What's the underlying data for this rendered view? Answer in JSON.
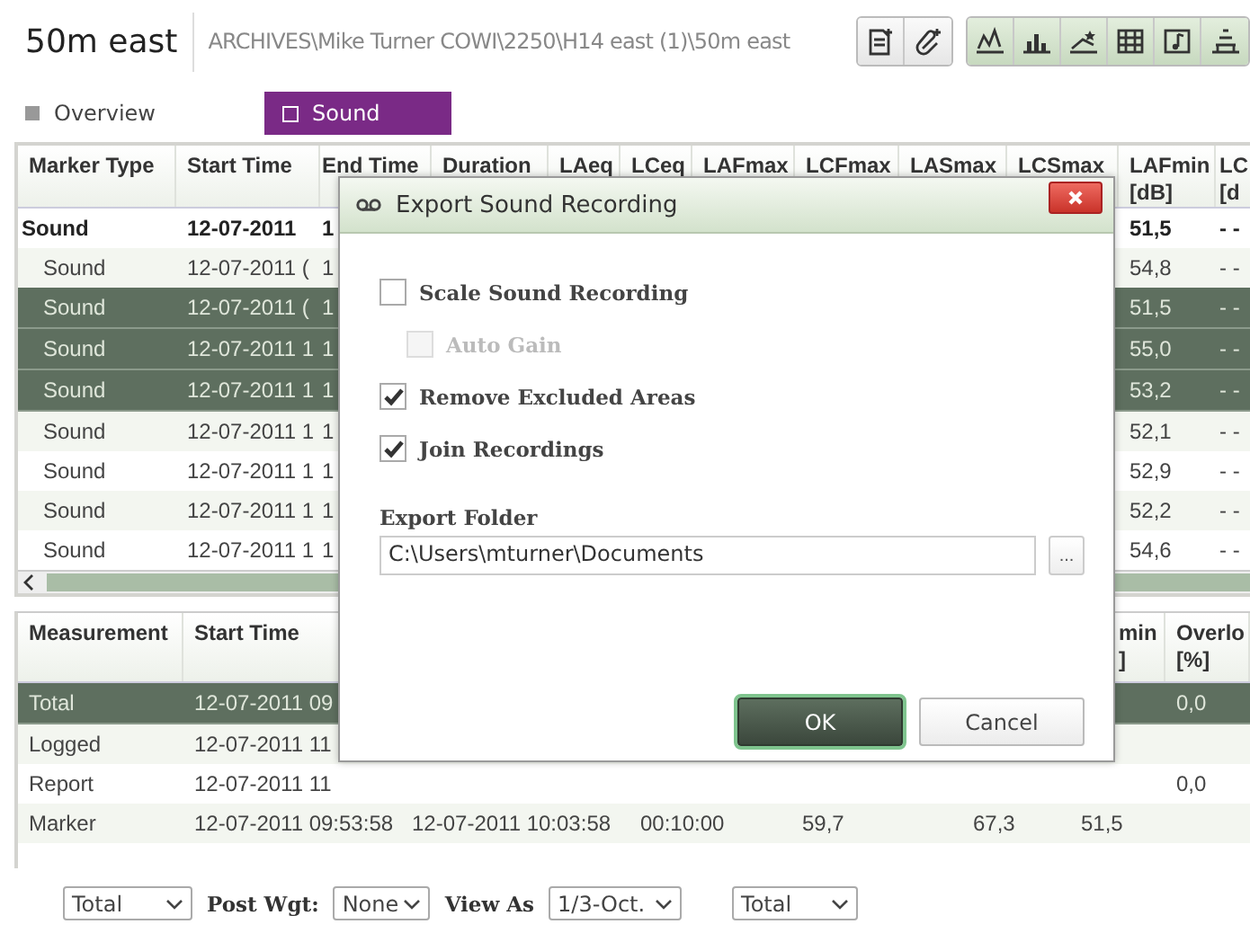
{
  "header": {
    "title": "50m east",
    "path": "ARCHIVES\\Mike Turner COWI\\2250\\H14 east (1)\\50m east"
  },
  "tabs": [
    {
      "label": "Overview",
      "selected": false
    },
    {
      "label": "Sound",
      "selected": true
    }
  ],
  "marker_table": {
    "columns": [
      "Marker Type",
      "Start Time",
      "End Time",
      "Duration",
      "LAeq",
      "LCeq",
      "LAFmax",
      "LCFmax",
      "LASmax",
      "LCSmax",
      "LAFmin\n[dB]",
      "LC\n[d"
    ],
    "rows": [
      {
        "kind": "summary",
        "selected": false,
        "cells": [
          "Sound",
          "12-07-2011",
          "1",
          null,
          null,
          null,
          null,
          null,
          null,
          null,
          "51,5",
          "- -"
        ]
      },
      {
        "kind": "item",
        "selected": false,
        "cells": [
          "Sound",
          "12-07-2011 (",
          "1",
          null,
          null,
          null,
          null,
          null,
          null,
          null,
          "54,8",
          "- -"
        ]
      },
      {
        "kind": "item",
        "selected": true,
        "cells": [
          "Sound",
          "12-07-2011 (",
          "1",
          null,
          null,
          null,
          null,
          null,
          null,
          null,
          "51,5",
          "- -"
        ]
      },
      {
        "kind": "item",
        "selected": true,
        "cells": [
          "Sound",
          "12-07-2011 1",
          "1",
          null,
          null,
          null,
          null,
          null,
          null,
          null,
          "55,0",
          "- -"
        ]
      },
      {
        "kind": "item",
        "selected": true,
        "cells": [
          "Sound",
          "12-07-2011 1",
          "1",
          null,
          null,
          null,
          null,
          null,
          null,
          null,
          "53,2",
          "- -"
        ]
      },
      {
        "kind": "item",
        "selected": false,
        "cells": [
          "Sound",
          "12-07-2011 1",
          "1",
          null,
          null,
          null,
          null,
          null,
          null,
          null,
          "52,1",
          "- -"
        ]
      },
      {
        "kind": "item",
        "selected": false,
        "cells": [
          "Sound",
          "12-07-2011 1",
          "1",
          null,
          null,
          null,
          null,
          null,
          null,
          null,
          "52,9",
          "- -"
        ]
      },
      {
        "kind": "item",
        "selected": false,
        "cells": [
          "Sound",
          "12-07-2011 1",
          "1",
          null,
          null,
          null,
          null,
          null,
          null,
          null,
          "52,2",
          "- -"
        ]
      },
      {
        "kind": "item",
        "selected": false,
        "cells": [
          "Sound",
          "12-07-2011 1",
          "1",
          null,
          null,
          null,
          null,
          null,
          null,
          null,
          "54,6",
          "- -"
        ]
      }
    ]
  },
  "measurement_table": {
    "columns": [
      "Measurement",
      "Start Time",
      null,
      null,
      null,
      null,
      null,
      "min\n]",
      "Overlo\n[%]"
    ],
    "rows": [
      {
        "selected": true,
        "cells": [
          "Total",
          "12-07-2011 09",
          null,
          null,
          null,
          null,
          null,
          null,
          "0,0"
        ]
      },
      {
        "selected": false,
        "cells": [
          "Logged",
          "12-07-2011 11",
          null,
          null,
          null,
          null,
          null,
          null,
          null
        ]
      },
      {
        "selected": false,
        "cells": [
          "Report",
          "12-07-2011 11",
          null,
          null,
          null,
          null,
          null,
          null,
          "0,0"
        ]
      },
      {
        "selected": false,
        "cells": [
          "Marker",
          "12-07-2011 09:53:58",
          "12-07-2011 10:03:58",
          "00:10:00",
          "59,7",
          null,
          "67,3",
          "51,5",
          null
        ]
      }
    ]
  },
  "dialog": {
    "title": "Export Sound Recording",
    "options": [
      {
        "label": "Scale Sound Recording",
        "checked": false,
        "disabled": false,
        "indented": false
      },
      {
        "label": "Auto Gain",
        "checked": false,
        "disabled": true,
        "indented": true
      },
      {
        "label": "Remove Excluded Areas",
        "checked": true,
        "disabled": false,
        "indented": false
      },
      {
        "label": "Join Recordings",
        "checked": true,
        "disabled": false,
        "indented": false
      }
    ],
    "folder_label": "Export Folder",
    "folder_value": "C:\\Users\\mturner\\Documents",
    "browse": "...",
    "buttons": [
      {
        "label": "OK",
        "kind": "primary"
      },
      {
        "label": "Cancel",
        "kind": "secondary"
      }
    ]
  },
  "bottom_bar": [
    {
      "kind": "select",
      "text": "Total"
    },
    {
      "kind": "label",
      "text": "Post Wgt:"
    },
    {
      "kind": "select",
      "text": "None"
    },
    {
      "kind": "label",
      "text": "View As"
    },
    {
      "kind": "select",
      "text": "1/3-Oct."
    },
    {
      "kind": "select",
      "text": "Total"
    }
  ]
}
